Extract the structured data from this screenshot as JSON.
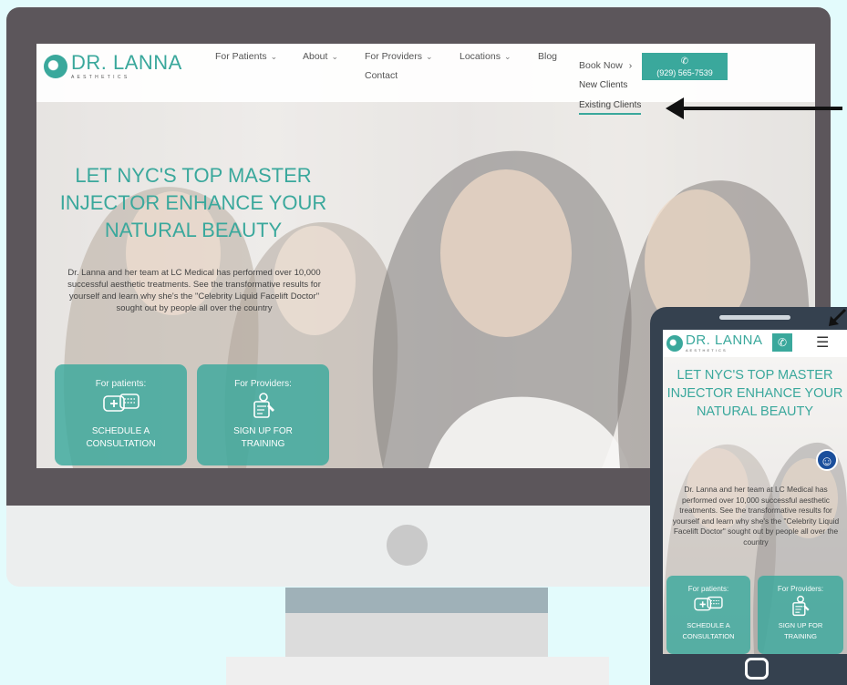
{
  "brand": {
    "name": "DR. LANNA",
    "sub": "A E S T H E T I C S"
  },
  "nav": {
    "items": [
      {
        "label": "For Patients",
        "chevron": "chevron-down-icon"
      },
      {
        "label": "About",
        "chevron": "chevron-down-icon"
      },
      {
        "label": "For Providers",
        "chevron": "chevron-down-icon"
      },
      {
        "label": "Locations",
        "chevron": "chevron-down-icon"
      },
      {
        "label": "Blog"
      }
    ],
    "contact": "Contact",
    "book_now": "Book Now",
    "book_now_icon": "chevron-right-icon",
    "phone": "(929) 565-7539",
    "dropdown": [
      "New Clients",
      "Existing Clients"
    ]
  },
  "hero": {
    "title": "LET NYC'S TOP MASTER INJECTOR ENHANCE YOUR NATURAL BEAUTY",
    "text": "Dr. Lanna and her team at LC Medical has performed over 10,000 successful aesthetic treatments. See the transformative results for yourself and learn why she's the \"Celebrity Liquid Facelift Doctor\" sought out by people all over the country"
  },
  "cta": [
    {
      "kicker": "For patients:",
      "main": "SCHEDULE A CONSULTATION",
      "icon": "chat-plus-icon"
    },
    {
      "kicker": "For Providers:",
      "main": "SIGN UP FOR TRAINING",
      "icon": "training-icon"
    }
  ],
  "mobile": {
    "hero_title": "LET NYC'S TOP MASTER INJECTOR ENHANCE YOUR NATURAL BEAUTY",
    "hero_text": "Dr. Lanna and her team at LC Medical has performed over 10,000 successful aesthetic treatments. See the transformative results for yourself and learn why she's the \"Celebrity Liquid Facelift Doctor\" sought out by people all over the country",
    "menu_icon": "hamburger-icon",
    "call_icon": "phone-icon",
    "accessibility_icon": "accessibility-icon"
  },
  "colors": {
    "accent": "#3aa89c",
    "bezel": "#5c565b",
    "phone_body": "#35414f",
    "background": "#e3fbfc"
  }
}
